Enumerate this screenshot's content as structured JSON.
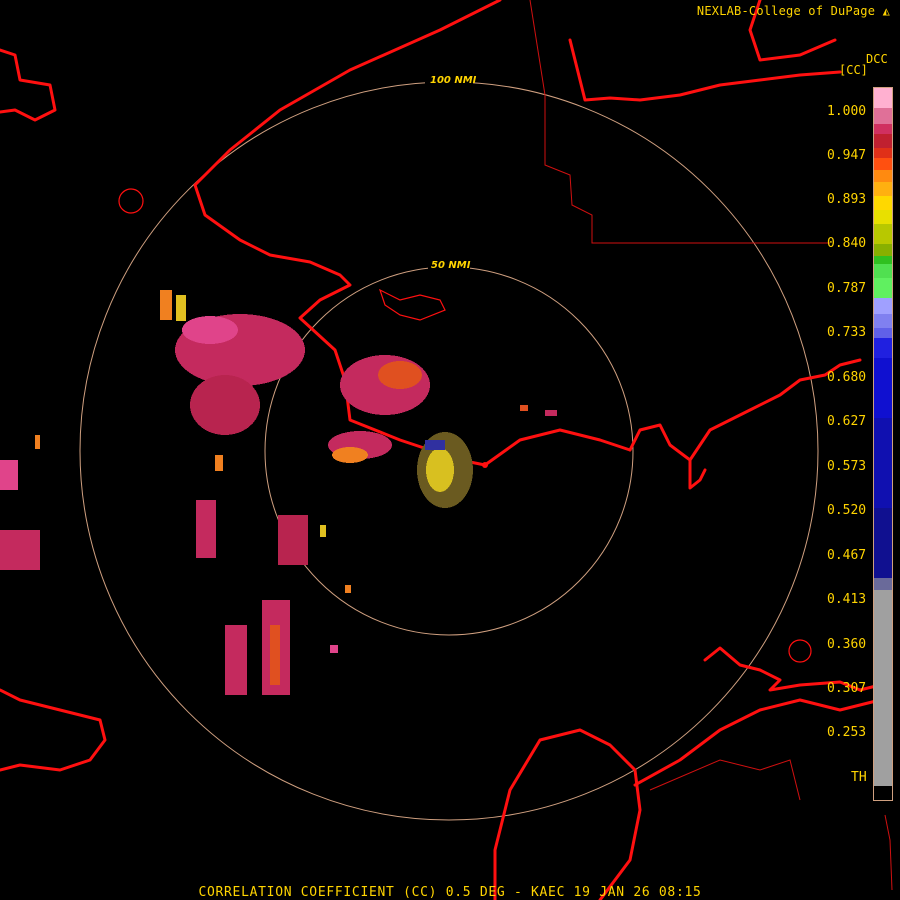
{
  "header": {
    "credit": "NEXLAB-College of DuPage"
  },
  "legend": {
    "unit": "DCC",
    "code": "[CC]",
    "ticks": [
      "1.000",
      "0.947",
      "0.893",
      "0.840",
      "0.787",
      "0.733",
      "0.680",
      "0.627",
      "0.573",
      "0.520",
      "0.467",
      "0.413",
      "0.360",
      "0.307",
      "0.253",
      "TH"
    ]
  },
  "rings": {
    "inner": "50 NMI",
    "outer": "100 NMI"
  },
  "footer": {
    "title": "CORRELATION COEFFICIENT (CC) 0.5 DEG - KAEC 19 JAN 26 08:15"
  },
  "colors": {
    "background": "#000000",
    "boundaries": "#ff1010",
    "rings": "#d0a080",
    "text": "#ffd400"
  },
  "icons": {
    "credit_badge": "nexlab-logo-icon"
  }
}
